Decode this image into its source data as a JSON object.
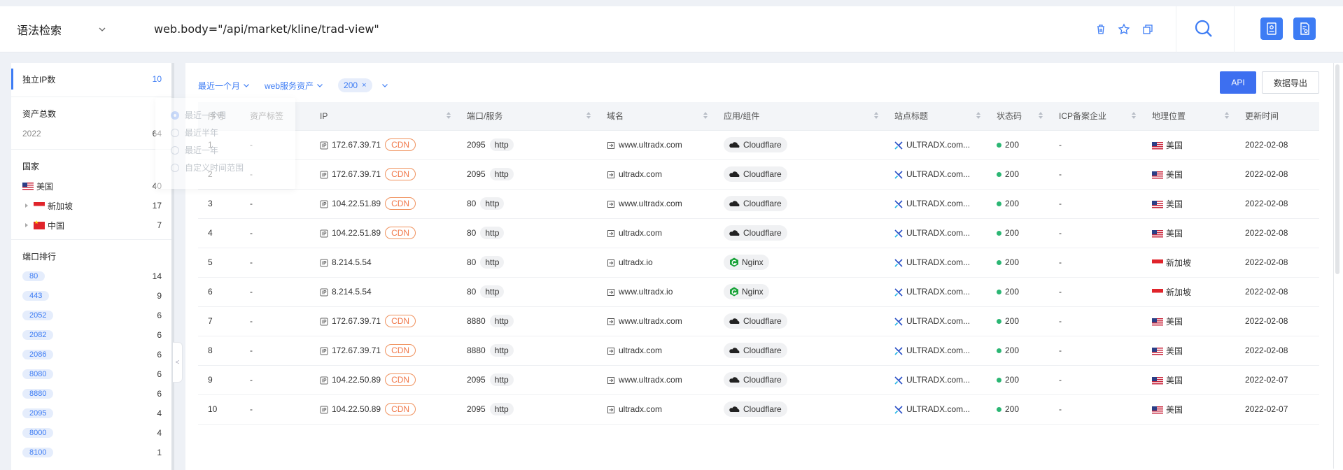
{
  "topbar": {
    "syntax_label": "语法检索",
    "query": "web.body=\"/api/market/kline/trad-view\""
  },
  "sidebar": {
    "ip_count": {
      "label": "独立IP数",
      "count": "10"
    },
    "assets": {
      "label": "资产总数",
      "sub": "2022",
      "count": "64"
    },
    "country": {
      "title": "国家",
      "items": [
        {
          "name": "美国",
          "count": "40"
        },
        {
          "name": "新加坡",
          "count": "17"
        },
        {
          "name": "中国",
          "count": "7"
        }
      ]
    },
    "ports": {
      "title": "端口排行",
      "items": [
        {
          "port": "80",
          "count": "14"
        },
        {
          "port": "443",
          "count": "9"
        },
        {
          "port": "2052",
          "count": "6"
        },
        {
          "port": "2082",
          "count": "6"
        },
        {
          "port": "2086",
          "count": "6"
        },
        {
          "port": "8080",
          "count": "6"
        },
        {
          "port": "8880",
          "count": "6"
        },
        {
          "port": "2095",
          "count": "4"
        },
        {
          "port": "8000",
          "count": "4"
        },
        {
          "port": "8100",
          "count": "1"
        }
      ]
    },
    "collapse_glyph": "<"
  },
  "filters": {
    "time": "最近一个月",
    "asset_type": "web服务资产",
    "status_chip": "200",
    "chip_close": "×"
  },
  "actions": {
    "api": "API",
    "export": "数据导出"
  },
  "dropdown": {
    "options": [
      "最近一个月",
      "最近半年",
      "最近一年",
      "自定义时间范围"
    ],
    "selected": 0
  },
  "table": {
    "headers": [
      "序号",
      "资产标签",
      "IP",
      "端口/服务",
      "域名",
      "应用/组件",
      "站点标题",
      "状态码",
      "ICP备案企业",
      "地理位置",
      "更新时间"
    ],
    "rows": [
      {
        "no": "1",
        "tag": "-",
        "ip": "172.67.39.71",
        "cdn": "CDN",
        "port": "2095",
        "proto": "http",
        "domain": "www.ultradx.com",
        "app": "Cloudflare",
        "title": "ULTRADX.com...",
        "status": "200",
        "icp": "-",
        "geo": "美国",
        "flag": "us",
        "date": "2022-02-08"
      },
      {
        "no": "2",
        "tag": "-",
        "ip": "172.67.39.71",
        "cdn": "CDN",
        "port": "2095",
        "proto": "http",
        "domain": "ultradx.com",
        "app": "Cloudflare",
        "title": "ULTRADX.com...",
        "status": "200",
        "icp": "-",
        "geo": "美国",
        "flag": "us",
        "date": "2022-02-08"
      },
      {
        "no": "3",
        "tag": "-",
        "ip": "104.22.51.89",
        "cdn": "CDN",
        "port": "80",
        "proto": "http",
        "domain": "www.ultradx.com",
        "app": "Cloudflare",
        "title": "ULTRADX.com...",
        "status": "200",
        "icp": "-",
        "geo": "美国",
        "flag": "us",
        "date": "2022-02-08"
      },
      {
        "no": "4",
        "tag": "-",
        "ip": "104.22.51.89",
        "cdn": "CDN",
        "port": "80",
        "proto": "http",
        "domain": "ultradx.com",
        "app": "Cloudflare",
        "title": "ULTRADX.com...",
        "status": "200",
        "icp": "-",
        "geo": "美国",
        "flag": "us",
        "date": "2022-02-08"
      },
      {
        "no": "5",
        "tag": "-",
        "ip": "8.214.5.54",
        "cdn": "",
        "port": "80",
        "proto": "http",
        "domain": "ultradx.io",
        "app": "Nginx",
        "title": "ULTRADX.com...",
        "status": "200",
        "icp": "-",
        "geo": "新加坡",
        "flag": "sg",
        "date": "2022-02-08"
      },
      {
        "no": "6",
        "tag": "-",
        "ip": "8.214.5.54",
        "cdn": "",
        "port": "80",
        "proto": "http",
        "domain": "www.ultradx.io",
        "app": "Nginx",
        "title": "ULTRADX.com...",
        "status": "200",
        "icp": "-",
        "geo": "新加坡",
        "flag": "sg",
        "date": "2022-02-08"
      },
      {
        "no": "7",
        "tag": "-",
        "ip": "172.67.39.71",
        "cdn": "CDN",
        "port": "8880",
        "proto": "http",
        "domain": "www.ultradx.com",
        "app": "Cloudflare",
        "title": "ULTRADX.com...",
        "status": "200",
        "icp": "-",
        "geo": "美国",
        "flag": "us",
        "date": "2022-02-08"
      },
      {
        "no": "8",
        "tag": "-",
        "ip": "172.67.39.71",
        "cdn": "CDN",
        "port": "8880",
        "proto": "http",
        "domain": "ultradx.com",
        "app": "Cloudflare",
        "title": "ULTRADX.com...",
        "status": "200",
        "icp": "-",
        "geo": "美国",
        "flag": "us",
        "date": "2022-02-08"
      },
      {
        "no": "9",
        "tag": "-",
        "ip": "104.22.50.89",
        "cdn": "CDN",
        "port": "2095",
        "proto": "http",
        "domain": "www.ultradx.com",
        "app": "Cloudflare",
        "title": "ULTRADX.com...",
        "status": "200",
        "icp": "-",
        "geo": "美国",
        "flag": "us",
        "date": "2022-02-07"
      },
      {
        "no": "10",
        "tag": "-",
        "ip": "104.22.50.89",
        "cdn": "CDN",
        "port": "2095",
        "proto": "http",
        "domain": "ultradx.com",
        "app": "Cloudflare",
        "title": "ULTRADX.com...",
        "status": "200",
        "icp": "-",
        "geo": "美国",
        "flag": "us",
        "date": "2022-02-07"
      }
    ]
  },
  "colors": {
    "accent": "#3d7cf4",
    "cdn": "#f0784a",
    "status_ok": "#2bb673",
    "nginx": "#1aa33a"
  }
}
